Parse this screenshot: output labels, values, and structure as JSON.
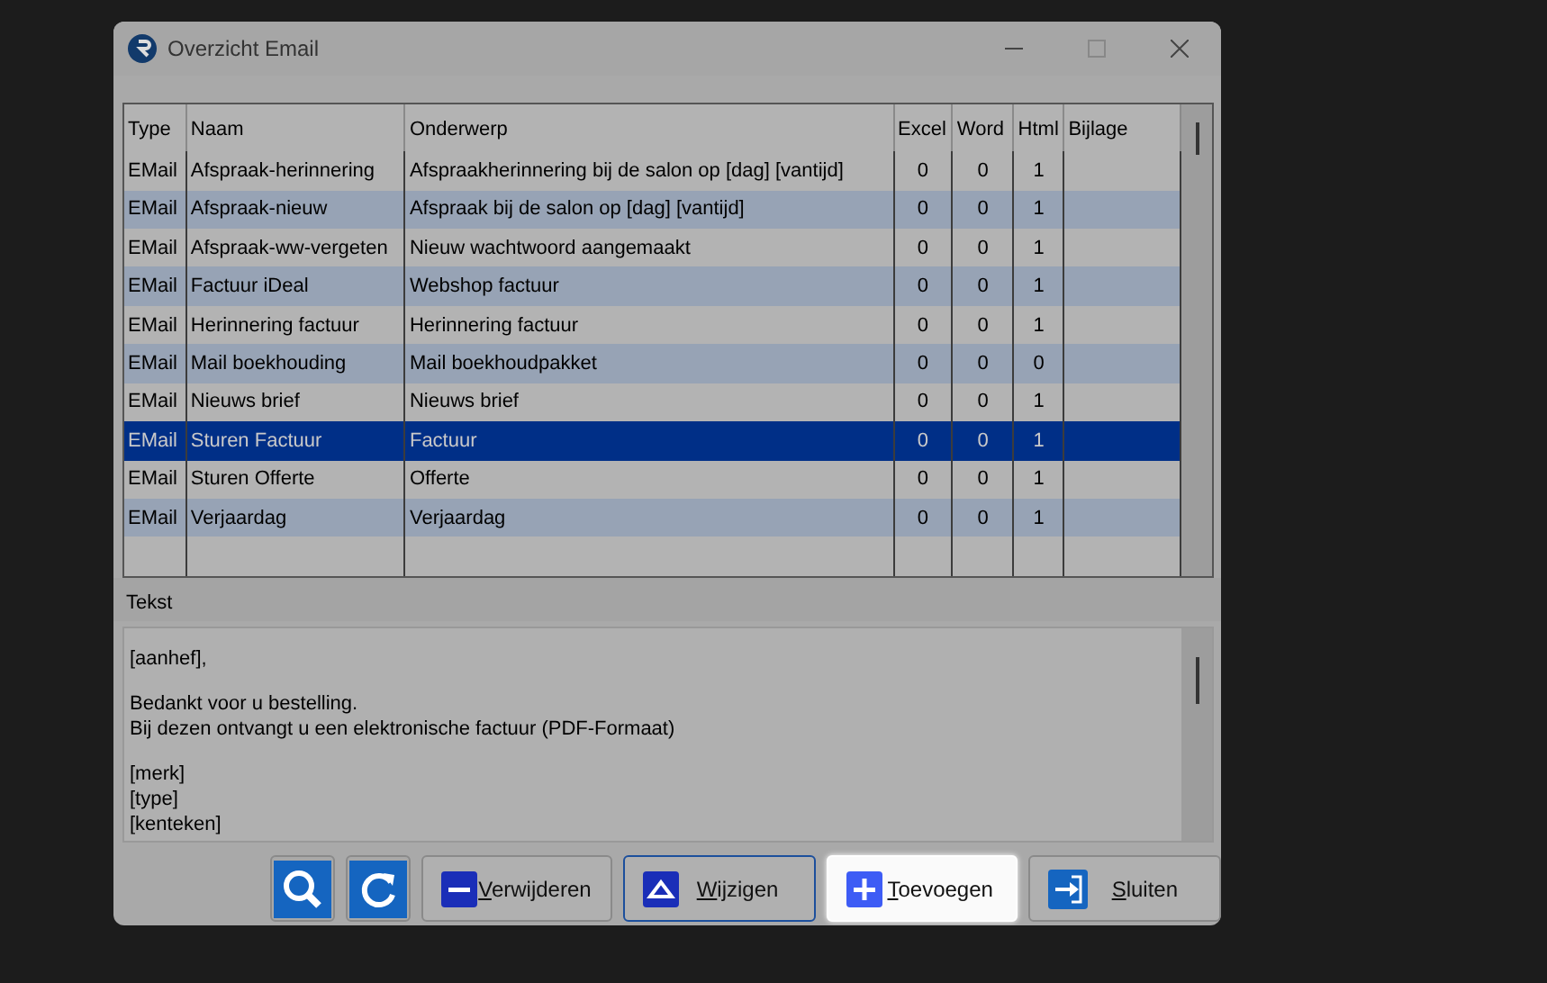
{
  "window": {
    "title": "Overzicht Email"
  },
  "table": {
    "columns": [
      "Type",
      "Naam",
      "Onderwerp",
      "Excel",
      "Word",
      "Html",
      "Bijlage"
    ],
    "rows": [
      {
        "cells": [
          "EMail",
          "Afspraak-herinnering",
          "Afspraakherinnering bij de salon op [dag] [vantijd]",
          "0",
          "0",
          "1"
        ],
        "selected": false
      },
      {
        "cells": [
          "EMail",
          "Afspraak-nieuw",
          "Afspraak bij de salon op [dag] [vantijd]",
          "0",
          "0",
          "1"
        ],
        "selected": false
      },
      {
        "cells": [
          "EMail",
          "Afspraak-ww-vergeten",
          "Nieuw wachtwoord aangemaakt",
          "0",
          "0",
          "1"
        ],
        "selected": false
      },
      {
        "cells": [
          "EMail",
          "Factuur iDeal",
          "Webshop factuur",
          "0",
          "0",
          "1"
        ],
        "selected": false
      },
      {
        "cells": [
          "EMail",
          "Herinnering factuur",
          "Herinnering factuur",
          "0",
          "0",
          "1"
        ],
        "selected": false
      },
      {
        "cells": [
          "EMail",
          "Mail boekhouding",
          "Mail boekhoudpakket",
          "0",
          "0",
          "0"
        ],
        "selected": false
      },
      {
        "cells": [
          "EMail",
          "Nieuws brief",
          "Nieuws brief",
          "0",
          "0",
          "1"
        ],
        "selected": false
      },
      {
        "cells": [
          "EMail",
          "Sturen Factuur",
          "Factuur",
          "0",
          "0",
          "1"
        ],
        "selected": true
      },
      {
        "cells": [
          "EMail",
          "Sturen Offerte",
          "Offerte",
          "0",
          "0",
          "1"
        ],
        "selected": false
      },
      {
        "cells": [
          "EMail",
          "Verjaardag",
          "Verjaardag",
          "0",
          "0",
          "1"
        ],
        "selected": false
      }
    ]
  },
  "text_section": {
    "label": "Tekst",
    "paragraphs": [
      [
        "[aanhef],"
      ],
      [
        "Bedankt voor u bestelling.",
        "Bij dezen ontvangt u een elektronische factuur (PDF-Formaat)"
      ],
      [
        "[merk]",
        "[type]",
        "[kenteken]"
      ]
    ]
  },
  "buttons": [
    {
      "kind": "search",
      "default": false,
      "highlighted": false
    },
    {
      "kind": "refresh",
      "default": false,
      "highlighted": false
    },
    {
      "kind": "delete",
      "label": "Verwijderen",
      "default": false,
      "highlighted": false
    },
    {
      "kind": "edit",
      "label": "Wijzigen",
      "default": true,
      "highlighted": false
    },
    {
      "kind": "add",
      "label": "Toevoegen",
      "default": false,
      "highlighted": true
    },
    {
      "kind": "close",
      "label": "Sluiten",
      "default": false,
      "highlighted": false
    }
  ]
}
